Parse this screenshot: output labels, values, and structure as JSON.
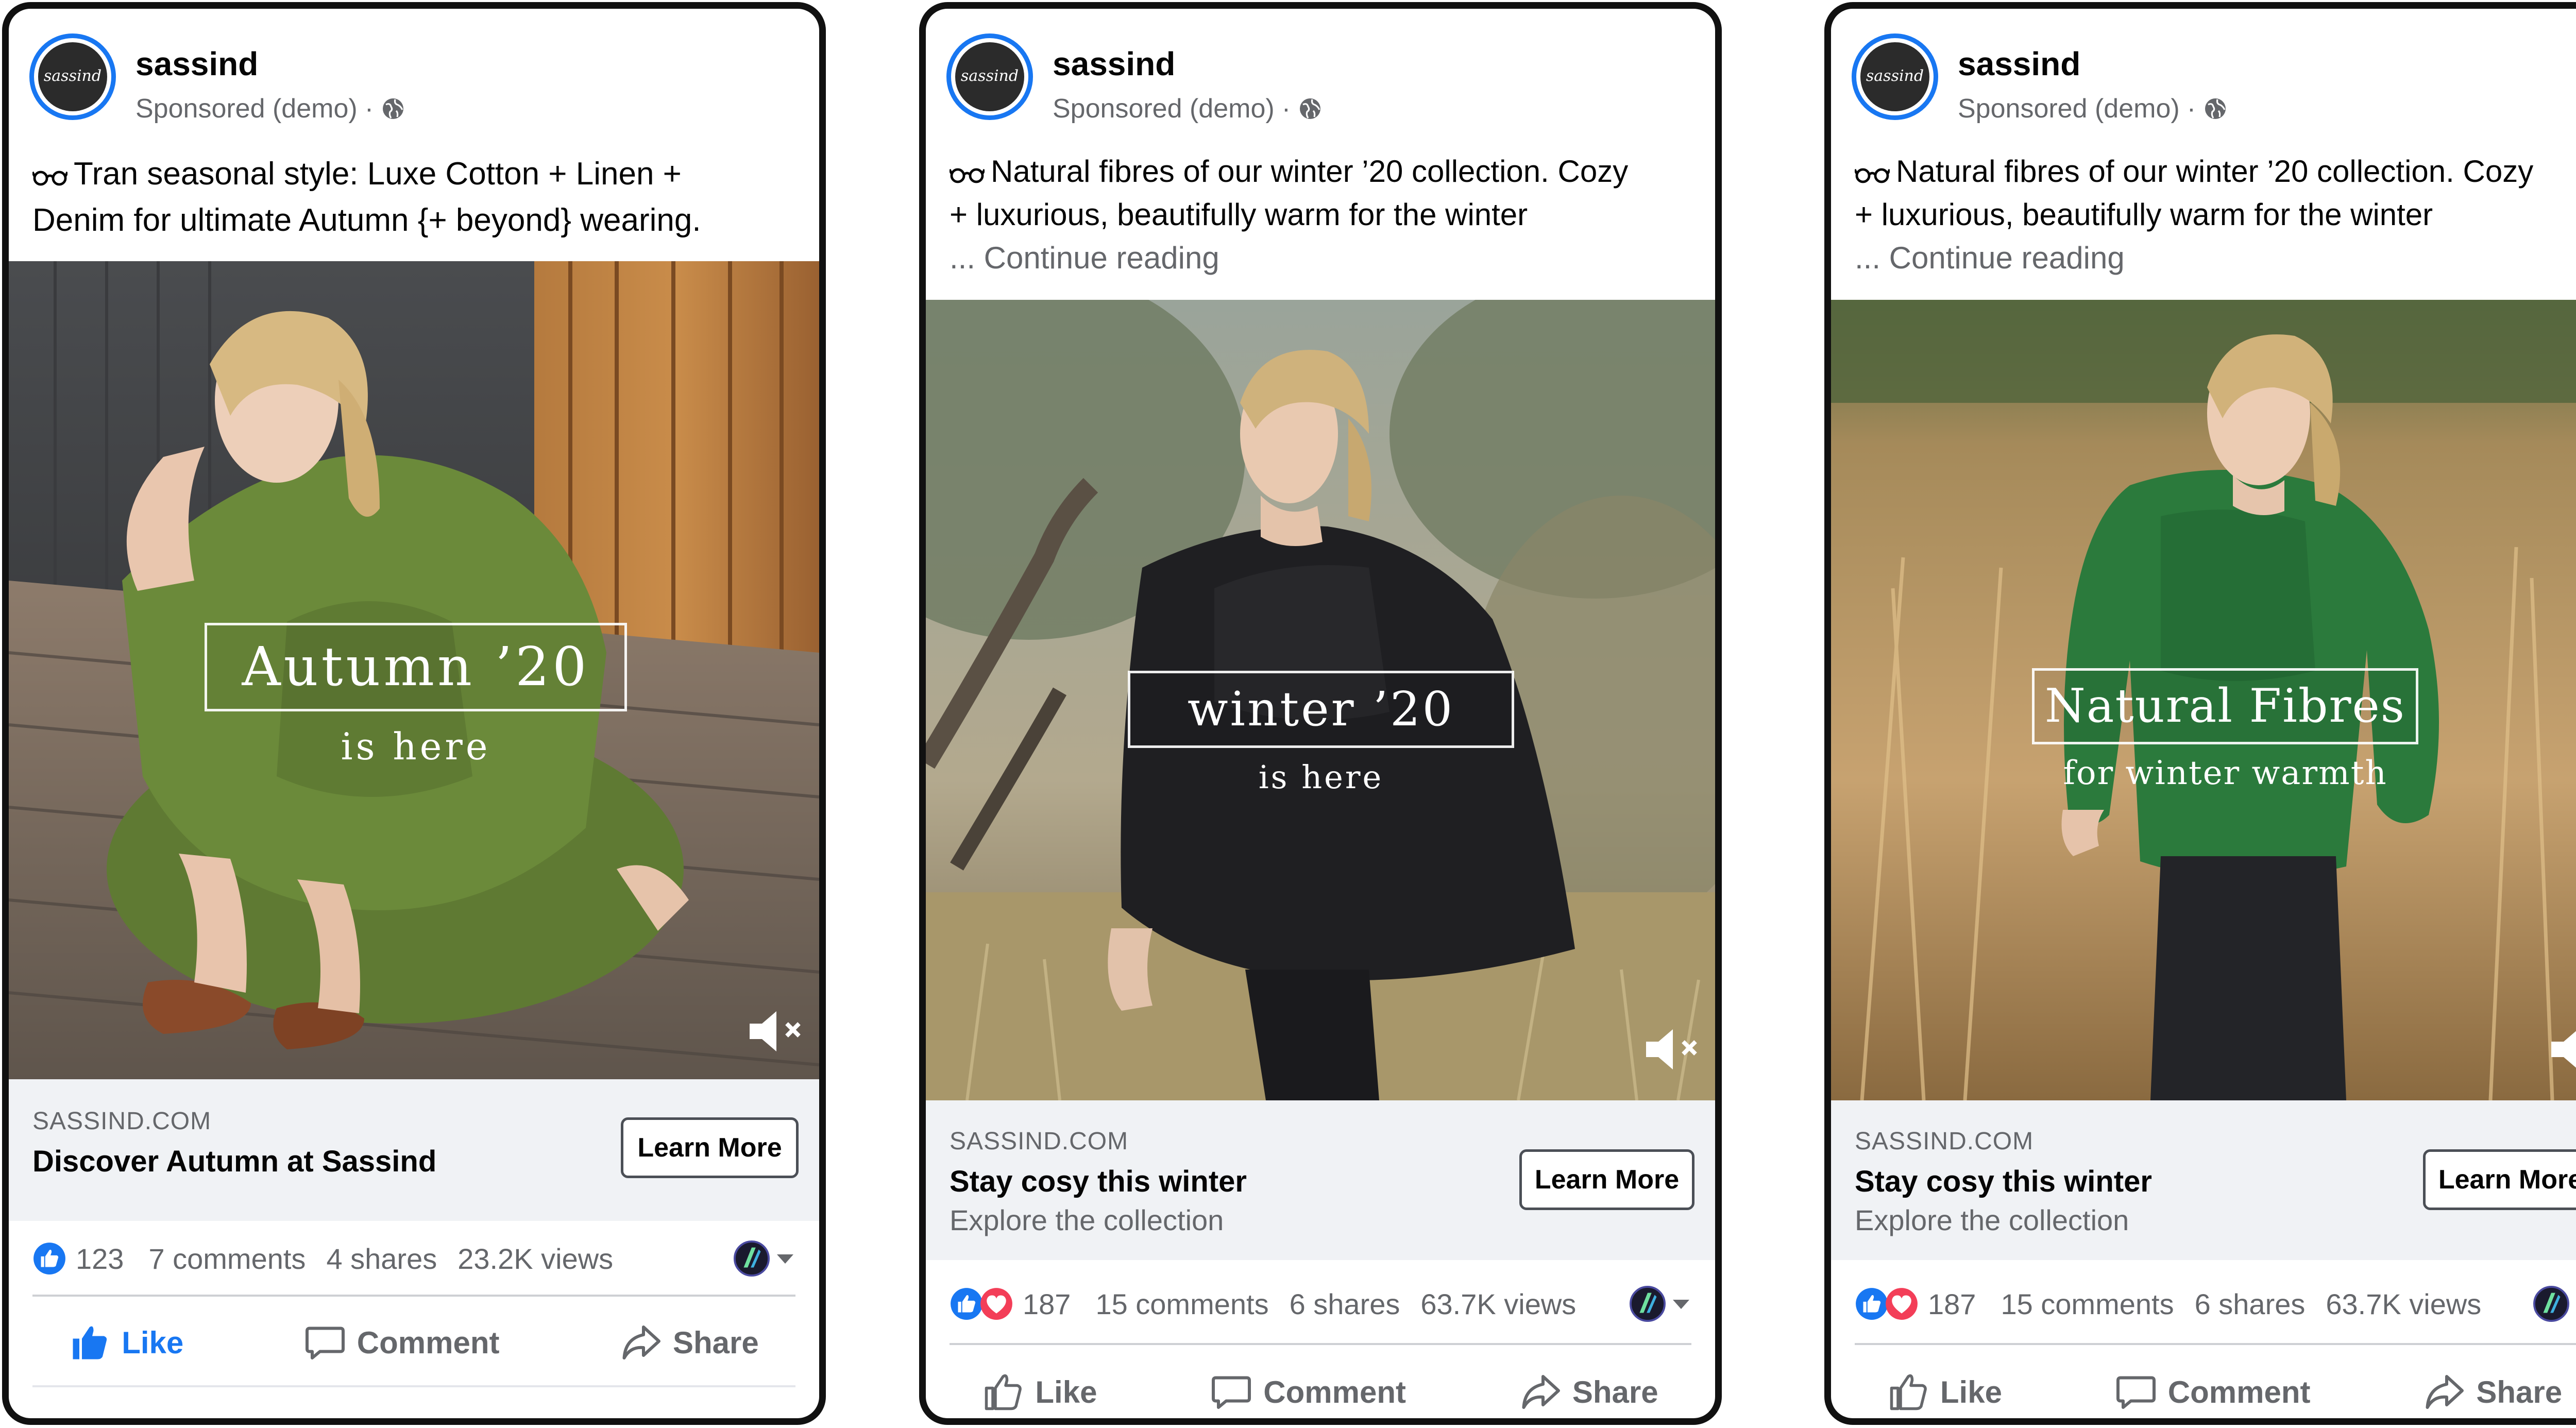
{
  "cards": [
    {
      "page_name": "sassind",
      "sponsored": "Sponsored (demo)",
      "separator": "·",
      "caption_lines": [
        "Tran seasonal style: Luxe Cotton + Linen +",
        "Denim for ultimate Autumn {+ beyond} wearing."
      ],
      "overlay_title": "Autumn ’20",
      "overlay_sub": "is here",
      "domain": "SASSIND.COM",
      "headline": "Discover Autumn at Sassind",
      "description": "",
      "cta_label": "Learn More",
      "reactions": [
        "like"
      ],
      "reaction_count": "123",
      "comments": "7 comments",
      "shares": "4 shares",
      "views": "23.2K views",
      "actions": {
        "like": "Like",
        "comment": "Comment",
        "share": "Share"
      },
      "liked": true
    },
    {
      "page_name": "sassind",
      "sponsored": "Sponsored (demo)",
      "separator": "·",
      "caption_lines": [
        "Natural fibres of our winter ’20 collection. Cozy",
        "+ luxurious, beautifully warm for the winter"
      ],
      "continue_text": "... Continue reading",
      "overlay_title": "winter ’20",
      "overlay_sub": "is here",
      "domain": "SASSIND.COM",
      "headline": "Stay cosy this winter",
      "description": "Explore the collection",
      "cta_label": "Learn More",
      "reactions": [
        "like",
        "love"
      ],
      "reaction_count": "187",
      "comments": "15 comments",
      "shares": "6 shares",
      "views": "63.7K views",
      "actions": {
        "like": "Like",
        "comment": "Comment",
        "share": "Share"
      },
      "liked": false
    },
    {
      "page_name": "sassind",
      "sponsored": "Sponsored (demo)",
      "separator": "·",
      "caption_lines": [
        "Natural fibres of our winter ’20 collection. Cozy",
        "+ luxurious, beautifully warm for the winter"
      ],
      "continue_text": "... Continue reading",
      "overlay_title": "Natural Fibres",
      "overlay_sub": "for winter warmth",
      "domain": "SASSIND.COM",
      "headline": "Stay cosy this winter",
      "description": "Explore the collection",
      "cta_label": "Learn More",
      "reactions": [
        "like",
        "love"
      ],
      "reaction_count": "187",
      "comments": "15 comments",
      "shares": "6 shares",
      "views": "63.7K views",
      "actions": {
        "like": "Like",
        "comment": "Comment",
        "share": "Share"
      },
      "liked": false
    }
  ],
  "avatar_logo_text": "sassind",
  "icons": {
    "globe": "globe-icon",
    "caption_emoji": "eyeglasses-emoji-icon",
    "mute": "speaker-muted-icon",
    "reaction_like": "thumbs-up-reaction-icon",
    "reaction_love": "heart-reaction-icon",
    "page_small": "page-avatar-icon",
    "caret": "caret-down-icon",
    "like": "thumbs-up-icon",
    "comment": "speech-bubble-icon",
    "share": "share-arrow-icon"
  },
  "colors": {
    "facebook_blue": "#1877f2",
    "love_red": "#f33e58",
    "secondary_text": "#65676b",
    "cta_background": "#f0f2f5",
    "card_border": "#111111"
  }
}
